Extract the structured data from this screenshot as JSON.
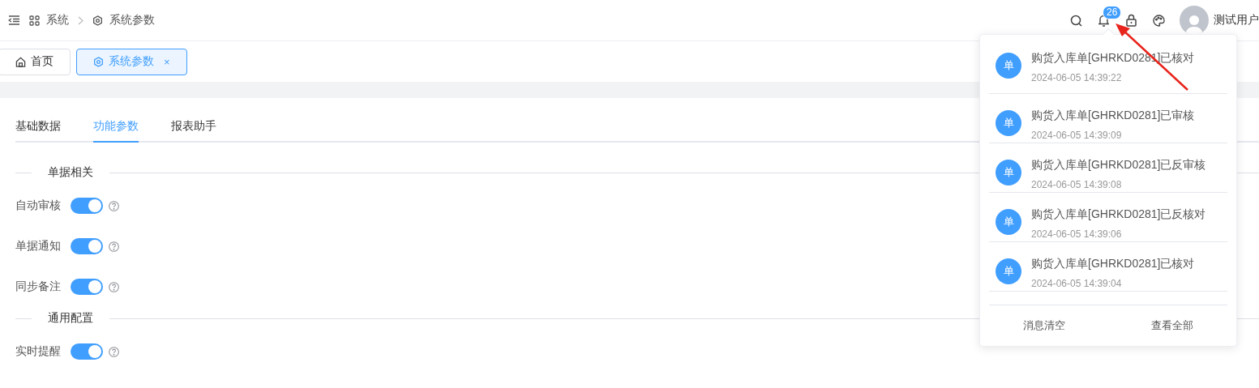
{
  "header": {
    "breadcrumb": [
      {
        "label": "系统",
        "kind": "apps"
      },
      {
        "label": "系统参数",
        "kind": "gear"
      }
    ],
    "notification_count": "26",
    "user": {
      "name": "测试用户"
    }
  },
  "page_tabs": [
    {
      "label": "首页",
      "kind": "home",
      "selected": false
    },
    {
      "label": "系统参数",
      "kind": "gear",
      "selected": true,
      "close": "×"
    }
  ],
  "settings": {
    "tabs": [
      {
        "label": "基础数据",
        "selected": false
      },
      {
        "label": "功能参数",
        "selected": true
      },
      {
        "label": "报表助手",
        "selected": false
      }
    ],
    "sections": [
      {
        "title": "单据相关",
        "options": [
          {
            "label": "自动审核",
            "on": true
          },
          {
            "label": "单据通知",
            "on": true
          },
          {
            "label": "同步备注",
            "on": true
          }
        ]
      },
      {
        "title": "通用配置",
        "options": [
          {
            "label": "实时提醒",
            "on": true
          }
        ]
      }
    ]
  },
  "notifications": {
    "items": [
      {
        "avatar": "单",
        "title": "购货入库单[GHRKD0281]已核对",
        "time": "2024-06-05 14:39:22"
      },
      {
        "avatar": "单",
        "title": "购货入库单[GHRKD0281]已审核",
        "time": "2024-06-05 14:39:09"
      },
      {
        "avatar": "单",
        "title": "购货入库单[GHRKD0281]已反审核",
        "time": "2024-06-05 14:39:08"
      },
      {
        "avatar": "单",
        "title": "购货入库单[GHRKD0281]已反核对",
        "time": "2024-06-05 14:39:06"
      },
      {
        "avatar": "单",
        "title": "购货入库单[GHRKD0281]已核对",
        "time": "2024-06-05 14:39:04"
      }
    ],
    "actions": [
      "消息清空",
      "查看全部"
    ]
  }
}
